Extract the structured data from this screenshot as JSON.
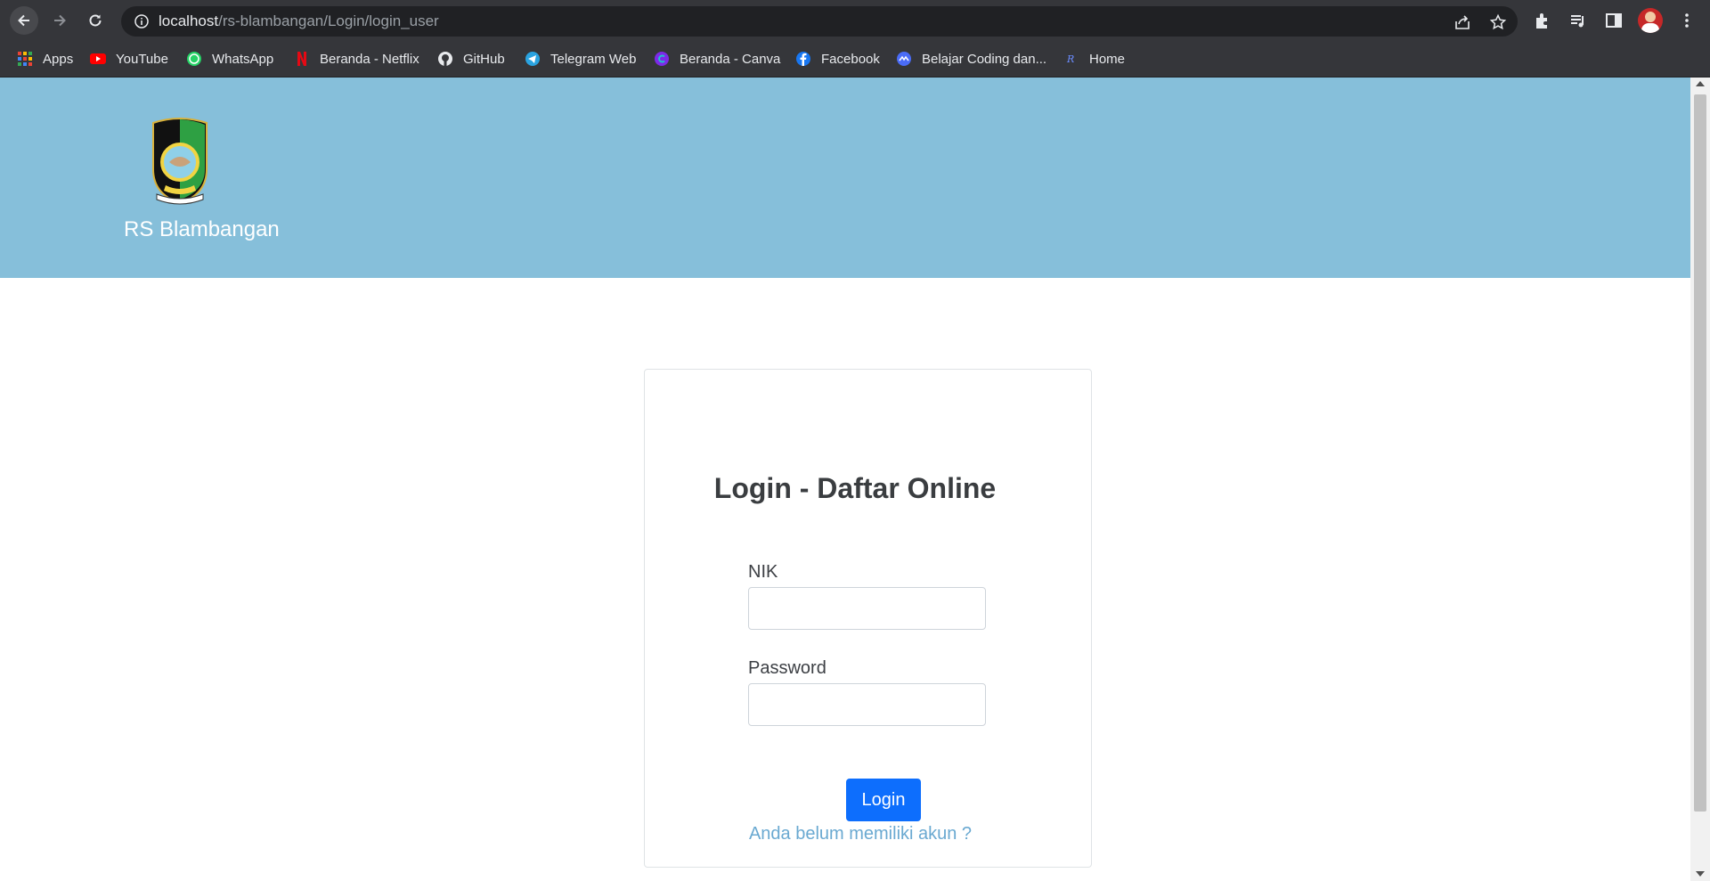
{
  "browser": {
    "url_host": "localhost",
    "url_path": "/rs-blambangan/Login/login_user",
    "bookmarks": [
      {
        "label": "Apps",
        "icon": "apps-grid-icon"
      },
      {
        "label": "YouTube",
        "icon": "youtube-icon"
      },
      {
        "label": "WhatsApp",
        "icon": "whatsapp-icon"
      },
      {
        "label": "Beranda - Netflix",
        "icon": "netflix-icon"
      },
      {
        "label": "GitHub",
        "icon": "github-icon"
      },
      {
        "label": "Telegram Web",
        "icon": "telegram-icon"
      },
      {
        "label": "Beranda - Canva",
        "icon": "canva-icon"
      },
      {
        "label": "Facebook",
        "icon": "facebook-icon"
      },
      {
        "label": "Belajar Coding dan...",
        "icon": "coding-icon"
      },
      {
        "label": "Home",
        "icon": "home-icon"
      }
    ]
  },
  "header": {
    "site_title": "RS Blambangan",
    "background_color": "#86bfda"
  },
  "login": {
    "title": "Login - Daftar Online",
    "nik_label": "NIK",
    "nik_value": "",
    "password_label": "Password",
    "password_value": "",
    "login_button": "Login",
    "register_link": "Anda belum memiliki akun ?",
    "button_color": "#0d6efd"
  }
}
